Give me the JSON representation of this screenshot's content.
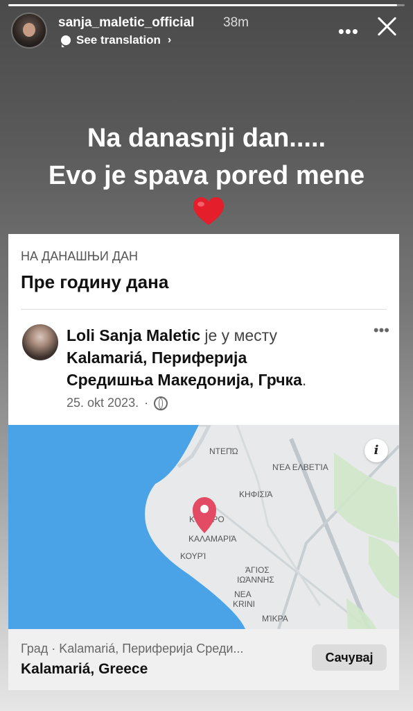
{
  "story": {
    "progress": 0.98,
    "username": "sanja_maletic_official",
    "time": "38m",
    "see_translation": "See translation",
    "caption_line1": "Na danasnji dan.....",
    "caption_line2": "Evo je spava pored mene",
    "heart_icon": "red-heart-icon"
  },
  "card": {
    "memory_title": "НА ДАНАШЊИ ДАН",
    "memory_subtitle": "Пре годину дана",
    "post": {
      "author": "Loli Sanja Maletic",
      "connector": "је у месту",
      "place_line1": "Kalamariá, Периферија",
      "place_line2": "Средишња Македонија, Грчка",
      "place_suffix": ".",
      "date": "25. okt 2023.",
      "separator": "·"
    },
    "map_labels": {
      "ntepo": "ΝΤΕΠΏ",
      "nea_elvetia": "ΝΈΑ ΕΛΒΕΤΊΑ",
      "kifisia": "ΚΗΦΙΣΙΆ",
      "kentro": "ΚΈΝΤΡΟ",
      "kalamaria": "ΚΑΛΑΜΑΡΙΆ",
      "kouri": "ΚΟΥΡΊ",
      "agios": "ΆΓΙΟΣ",
      "ioannis": "ΙΩΆΝΝΗΣ",
      "nea": "ΝΕΑ",
      "krini": "KRINI",
      "mikra": "ΜΊΚΡΑ"
    },
    "place": {
      "meta": "Град · Kalamariá, Периферија Среди...",
      "name": "Kalamariá, Greece",
      "save_label": "Сачувај"
    }
  },
  "colors": {
    "sea": "#4aa3e6",
    "land": "#e7e9ea",
    "pin": "#e24b63",
    "heart": "#e41e2b"
  }
}
